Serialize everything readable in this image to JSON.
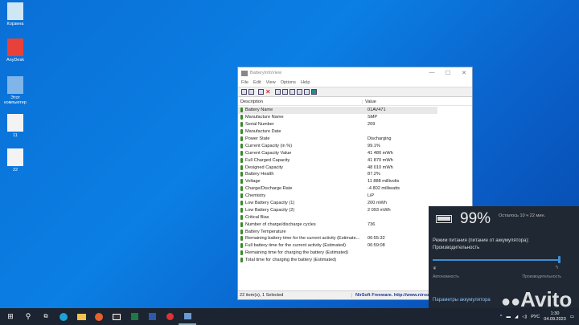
{
  "desktop": [
    {
      "label": "Корзина",
      "color": "#cfe6f5"
    },
    {
      "label": "AnyDesk",
      "color": "#e8413a"
    },
    {
      "label": "Этот компьютер",
      "color": "#7fb5e8"
    },
    {
      "label": "11",
      "color": "#f3f3f3"
    },
    {
      "label": "22",
      "color": "#f3f3f3"
    }
  ],
  "window": {
    "title": "BatteryInfoView",
    "controls": [
      "—",
      "☐",
      "✕"
    ],
    "menu": [
      "File",
      "Edit",
      "View",
      "Options",
      "Help"
    ],
    "columns": [
      "Description",
      "Value"
    ],
    "rows": [
      [
        "Battery Name",
        "01AV471"
      ],
      [
        "Manufacture Name",
        "SMP"
      ],
      [
        "Serial Number",
        " 209"
      ],
      [
        "Manufacture Date",
        ""
      ],
      [
        "Power State",
        "Discharging"
      ],
      [
        "Current Capacity (in %)",
        "99.1%"
      ],
      [
        "Current Capacity Value",
        "41 480 mWh"
      ],
      [
        "Full Charged Capacity",
        "41 870 mWh"
      ],
      [
        "Designed Capacity",
        "48 010 mWh"
      ],
      [
        "Battery Health",
        "87.2%"
      ],
      [
        "Voltage",
        "11 888 millivolts"
      ],
      [
        "Charge/Discharge Rate",
        "-4 802 milliwatts"
      ],
      [
        "Chemistry",
        "LiP"
      ],
      [
        "Low Battery Capacity (1)",
        "200 mWh"
      ],
      [
        "Low Battery Capacity (2)",
        "2 093 mWh"
      ],
      [
        "Critical Bias",
        ""
      ],
      [
        "Number of charge/discharge cycles",
        "736"
      ],
      [
        "Battery Temperature",
        ""
      ],
      [
        "Remaining battery time for the current activity (Estimate...",
        "06:55:32"
      ],
      [
        "Full battery time for the current activity (Estimated)",
        "06:59:08"
      ],
      [
        "Remaining time for charging the battery (Estimated)",
        ""
      ],
      [
        "Total  time for charging the battery (Estimated)",
        ""
      ]
    ],
    "status_left": "22 item(s), 1 Selected",
    "status_right": "NirSoft Freeware.  http://www.nirsof"
  },
  "flyout": {
    "percent": "99%",
    "remaining": "Осталось 10 ч 22 мин.",
    "mode_label": "Режим питания (питание от аккумулятора):",
    "mode_value": "Производительность",
    "slider_level": 1.0,
    "left_label": "Автономность",
    "right_label": "Производительность",
    "settings_link": "Параметры аккумулятора",
    "accent": "#3a8fd9"
  },
  "taskbar": {
    "icons": [
      "windows-start",
      "search",
      "task-view",
      "edge",
      "file-explorer",
      "firefox",
      "app",
      "excel",
      "word",
      "app-red",
      "batteryinfoview"
    ],
    "lang": "РУС",
    "time": "1:30",
    "date": "04.09.2023"
  },
  "watermark": "Avito"
}
